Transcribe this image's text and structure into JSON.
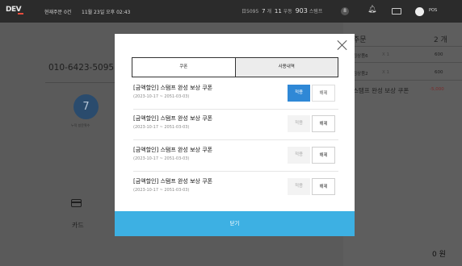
{
  "topbar": {
    "logo": "DEV",
    "orders_label": "현재주문 0건",
    "datetime": "11월 23일 오후 02:43",
    "stats": {
      "code": "日5095",
      "a_num": "7",
      "a_unit": "개",
      "b_num": "11",
      "b_unit": "우동",
      "c_num": "903",
      "c_unit": "스탬프"
    },
    "circle_badge": "8",
    "pos_label": "POS"
  },
  "left_panel": {
    "phone": "010-6423-5095",
    "stamp_count": "7",
    "stamp_label": "누적 방문횟수",
    "payment_method": "카드"
  },
  "order_panel": {
    "title": "주문",
    "count": "2 개",
    "items": [
      {
        "name": "김상품6",
        "qty": "X 1",
        "price": "600"
      },
      {
        "name": "김상품2",
        "qty": "X 1",
        "price": "600"
      }
    ],
    "coupon_name": "스탬프 완성 보상 쿠폰",
    "coupon_discount": "-5,000",
    "total": "0 원"
  },
  "modal": {
    "tabs": [
      {
        "label": "쿠폰",
        "active": true
      },
      {
        "label": "사용내역",
        "active": false
      }
    ],
    "coupons": [
      {
        "name": "[금액할인] 스탬프 완성 보상 쿠폰",
        "period": "(2023-10-17 ~ 2051-03-03)",
        "apply": "적용",
        "release": "해제",
        "applied": true
      },
      {
        "name": "[금액할인] 스탬프 완성 보상 쿠폰",
        "period": "(2023-10-17 ~ 2051-03-03)",
        "apply": "적용",
        "release": "해제",
        "applied": false
      },
      {
        "name": "[금액할인] 스탬프 완성 보상 쿠폰",
        "period": "(2023-10-17 ~ 2051-03-03)",
        "apply": "적용",
        "release": "해제",
        "applied": false
      },
      {
        "name": "[금액할인] 스탬프 완성 보상 쿠폰",
        "period": "(2023-10-17 ~ 2051-03-03)",
        "apply": "적용",
        "release": "해제",
        "applied": false
      }
    ],
    "close_label": "닫기"
  },
  "colors": {
    "accent": "#3db0e3",
    "apply_active": "#2f88d6",
    "discount": "#7a2a2a"
  },
  "icons": {
    "close": "close-icon",
    "bell": "bell-icon",
    "keyboard": "keyboard-icon",
    "card": "card-icon"
  }
}
